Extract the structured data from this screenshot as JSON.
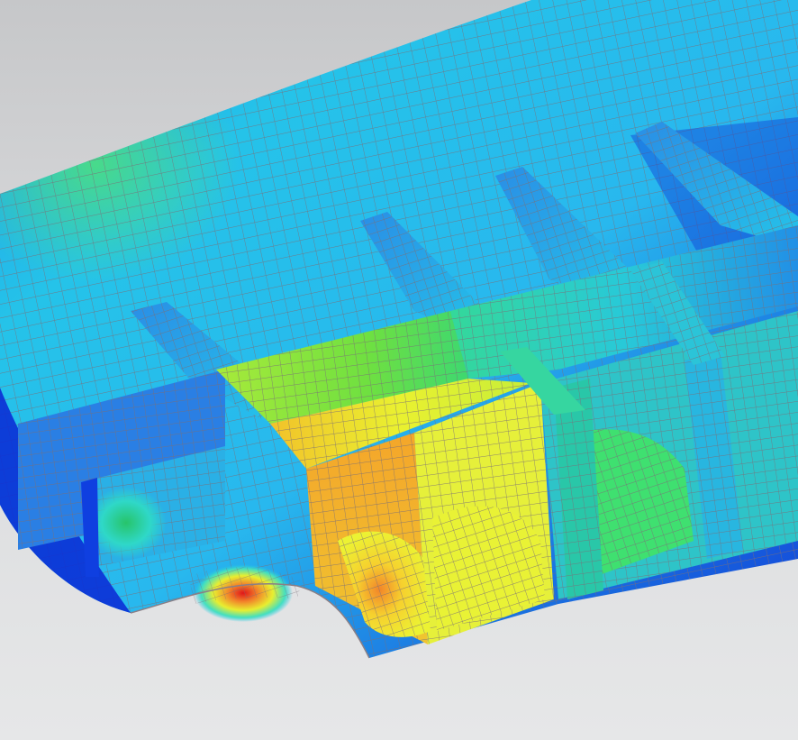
{
  "viewport": {
    "background_top": "#c6c7c9",
    "background_bottom": "#e6e7e8"
  },
  "model": {
    "mesh_line_color": "#7a6f78",
    "contour_colors": [
      "#0b2fd6",
      "#1a7fe8",
      "#22c6e6",
      "#2fe3a6",
      "#5fe64a",
      "#c8f23a",
      "#f7ee2c",
      "#f7b22a",
      "#ee5a1f",
      "#e0161a"
    ]
  }
}
